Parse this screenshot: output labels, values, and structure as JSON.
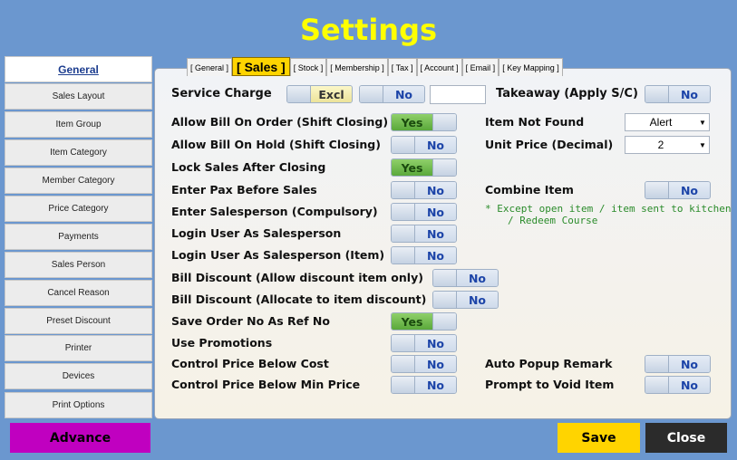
{
  "title": "Settings",
  "nav": [
    "General",
    "Sales Layout",
    "Item Group",
    "Item Category",
    "Member Category",
    "Price Category",
    "Payments",
    "Sales Person",
    "Cancel Reason",
    "Preset Discount",
    "Printer",
    "Devices",
    "Print Options"
  ],
  "tabs": [
    "[ General ]",
    "[ Sales ]",
    "[ Stock ]",
    "[ Membership ]",
    "[ Tax ]",
    "[ Account ]",
    "[ Email ]",
    "[ Key Mapping ]"
  ],
  "service_charge": {
    "label": "Service Charge",
    "excl": "Excl",
    "no": "No",
    "value": ""
  },
  "takeaway": {
    "label": "Takeaway (Apply S/C)",
    "value": "No"
  },
  "left_settings": [
    {
      "label": "Allow Bill On Order (Shift Closing)",
      "value": "Yes"
    },
    {
      "label": "Allow Bill On Hold (Shift Closing)",
      "value": "No"
    },
    {
      "label": "Lock Sales After Closing",
      "value": "Yes"
    },
    {
      "label": "Enter Pax Before Sales",
      "value": "No"
    },
    {
      "label": "Enter Salesperson (Compulsory)",
      "value": "No"
    },
    {
      "label": "Login User As Salesperson",
      "value": "No"
    },
    {
      "label": "Login User As Salesperson (Item)",
      "value": "No"
    },
    {
      "label": "Bill Discount (Allow discount item only)",
      "value": "No"
    },
    {
      "label": "Bill Discount (Allocate to item discount)",
      "value": "No"
    },
    {
      "label": "Save Order No As Ref No",
      "value": "Yes"
    },
    {
      "label": "Use Promotions",
      "value": "No"
    },
    {
      "label": "Control Price Below Cost",
      "value": "No"
    },
    {
      "label": "Control Price Below Min Price",
      "value": "No"
    }
  ],
  "item_not_found": {
    "label": "Item Not Found",
    "value": "Alert"
  },
  "unit_price": {
    "label": "Unit Price (Decimal)",
    "value": "2"
  },
  "combine_item": {
    "label": "Combine Item",
    "value": "No",
    "note_line1": "* Except open item / item sent to kitchen",
    "note_line2": "/ Redeem Course"
  },
  "auto_popup_remark": {
    "label": "Auto Popup Remark",
    "value": "No"
  },
  "prompt_void": {
    "label": "Prompt to Void Item",
    "value": "No"
  },
  "buttons": {
    "advance": "Advance",
    "save": "Save",
    "close": "Close"
  },
  "colors": {
    "background": "#6b97cf",
    "title": "#ffff00",
    "yes": "#5aa83a",
    "advance": "#c000c0",
    "save": "#ffd400",
    "close": "#2b2b2b"
  }
}
